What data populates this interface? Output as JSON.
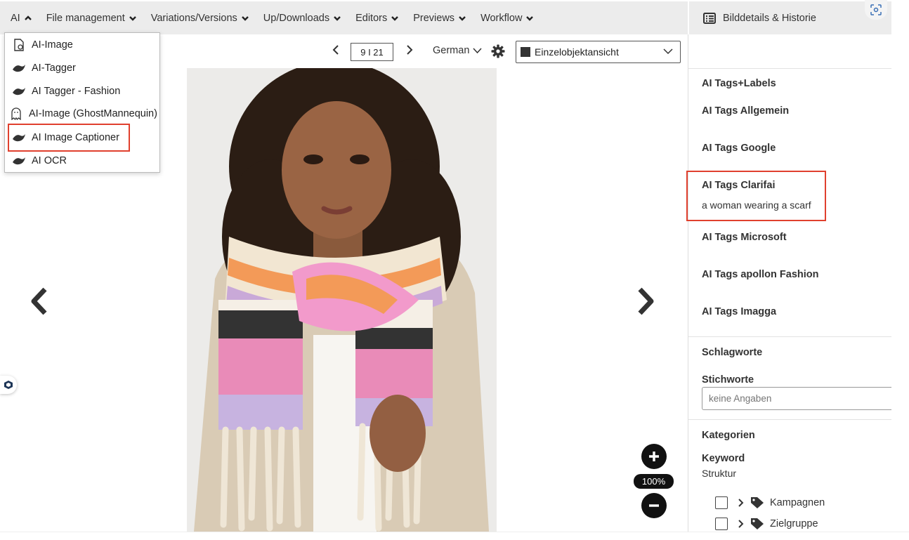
{
  "menubar": {
    "items": [
      {
        "label": "AI",
        "expanded": true
      },
      {
        "label": "File management"
      },
      {
        "label": "Variations/Versions"
      },
      {
        "label": "Up/Downloads"
      },
      {
        "label": "Editors"
      },
      {
        "label": "Previews"
      },
      {
        "label": "Workflow"
      }
    ]
  },
  "right_header": {
    "title": "Bilddetails & Historie"
  },
  "toolbar": {
    "pager": "9 I 21",
    "language": "German",
    "view": "Einzelobjektansicht"
  },
  "ai_menu": {
    "items": [
      {
        "label": "AI-Image",
        "icon": "ai-image-icon"
      },
      {
        "label": "AI-Tagger",
        "icon": "swoosh-icon"
      },
      {
        "label": "AI Tagger - Fashion",
        "icon": "swoosh-icon"
      },
      {
        "label": "AI-Image (GhostMannequin)",
        "icon": "ghost-icon"
      },
      {
        "label": "AI Image Captioner",
        "icon": "swoosh-icon",
        "highlighted": true
      },
      {
        "label": "AI OCR",
        "icon": "swoosh-icon"
      }
    ]
  },
  "viewer": {
    "zoom": "100%"
  },
  "panel": {
    "ai_tags_labels": "AI Tags+Labels",
    "allgemein": "AI Tags Allgemein",
    "google": "AI Tags Google",
    "clarifai": "AI Tags Clarifai",
    "clarifai_value": "a woman wearing a scarf",
    "microsoft": "AI Tags Microsoft",
    "apollon": "AI Tags apollon Fashion",
    "imagga": "AI Tags Imagga",
    "schlagworte": "Schlagworte",
    "stichworte": "Stichworte",
    "stichworte_placeholder": "keine Angaben",
    "kategorien": "Kategorien",
    "keyword": "Keyword",
    "struktur": "Struktur",
    "tree": [
      {
        "label": "Kampagnen",
        "checked": false
      },
      {
        "label": "Zielgruppe",
        "checked": false
      }
    ]
  },
  "colors": {
    "highlight": "#e0402e",
    "menubar_bg": "#ececec"
  }
}
